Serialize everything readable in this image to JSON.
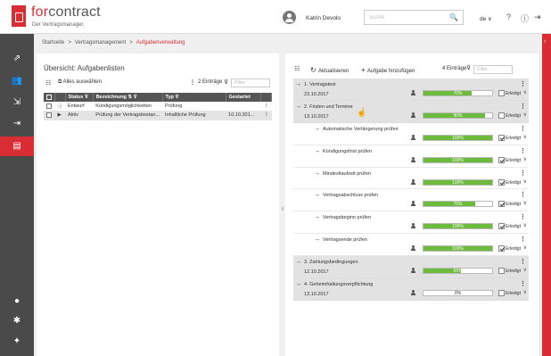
{
  "brand": {
    "logo_for": "for",
    "logo_contract": "contract",
    "subtitle": "Der Vertragsmanager."
  },
  "header": {
    "user_name": "Katrin Devolo",
    "search_placeholder": "Suche",
    "search_icon": "🔍",
    "language": "de ∨"
  },
  "header_icons": {
    "help": "?",
    "info": "ⓘ",
    "logout": "⇥"
  },
  "breadcrumb": {
    "items": [
      "Startseite",
      "Vertragsmanagement"
    ],
    "current": "Aufgabenverwaltung",
    "separator": ">"
  },
  "left_panel": {
    "title": "Übersicht: Aufgabenlisten",
    "select_all": "Alles auswählen",
    "count": "2 Einträge",
    "filter_placeholder": "Filter",
    "columns": [
      "Status",
      "Bezeichnung",
      "Typ",
      "Gestartet"
    ],
    "rows": [
      {
        "status_icon": "ⓘ",
        "status": "Entwurf",
        "name": "Kündigungsmöglichkeiten",
        "type": "Prüfung",
        "started": "",
        "selected": false
      },
      {
        "status_icon": "▶",
        "status": "Aktiv",
        "name": "Prüfung der Vertragsbestan...",
        "type": "Inhaltliche Prüfung",
        "started": "10.10.201...",
        "selected": true
      }
    ]
  },
  "right_panel": {
    "refresh": "Aktualisieren",
    "add_task": "Aufgabe hinzufügen",
    "count": "4 Einträge",
    "filter_placeholder": "Filter",
    "done_label": "Erledigt",
    "tasks": [
      {
        "name": "1. Vertragstext",
        "date": "23.10.2017",
        "progress": 70,
        "progress_label": "70%",
        "done": false,
        "sub": false
      },
      {
        "name": "2. Fristen und Termine",
        "date": "13.10.2017",
        "progress": 90,
        "progress_label": "90%",
        "done": false,
        "sub": false
      },
      {
        "name": "Automatische Verlängerung prüfen",
        "date": "",
        "progress": 100,
        "progress_label": "100%",
        "done": true,
        "sub": true
      },
      {
        "name": "Kündigungsfrist prüfen",
        "date": "",
        "progress": 100,
        "progress_label": "100%",
        "done": true,
        "sub": true
      },
      {
        "name": "Mindestlaufzeit prüfen",
        "date": "",
        "progress": 100,
        "progress_label": "100%",
        "done": true,
        "sub": true
      },
      {
        "name": "Vertragsabschluss prüfen",
        "date": "",
        "progress": 75,
        "progress_label": "75%",
        "done": true,
        "sub": true
      },
      {
        "name": "Vertragsbeginn prüfen",
        "date": "",
        "progress": 100,
        "progress_label": "100%",
        "done": true,
        "sub": true
      },
      {
        "name": "Vertragsende prüfen",
        "date": "",
        "progress": 100,
        "progress_label": "100%",
        "done": true,
        "sub": true
      },
      {
        "name": "3. Zahlungsbedingungen",
        "date": "12.10.2017",
        "progress": 55,
        "progress_label": "55%",
        "done": false,
        "sub": false
      },
      {
        "name": "4. Geheimhaltungsverpflichtung",
        "date": "13.10.2017",
        "progress": 0,
        "progress_label": "0%",
        "done": false,
        "sub": false
      }
    ]
  },
  "colors": {
    "brand_red": "#d92d33",
    "nav_bg": "#4a4a4a",
    "progress_green": "#6dbb3c"
  }
}
